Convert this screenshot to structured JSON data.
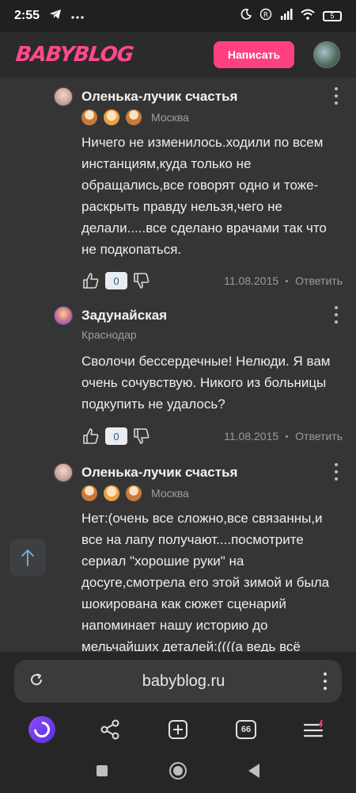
{
  "status_bar": {
    "time": "2:55",
    "battery": "5"
  },
  "header": {
    "logo": "BABYBLOG",
    "write_button": "Написать"
  },
  "comments": [
    {
      "author": "Оленька-лучик счастья",
      "city": "Москва",
      "text": "Ничего не изменилось.ходили по всем инстанциям,куда только не обращались,все говорят одно и тоже-раскрыть правду нельзя,чего не делали.....все сделано врачами так что не подкопаться.",
      "likes": "0",
      "date": "11.08.2015",
      "reply": "Ответить"
    },
    {
      "author": "Задунайская",
      "city": "Краснодар",
      "text": "Сволочи бессердечные! Нелюди. Я вам очень сочувствую. Никого из больницы подкупить не удалось?",
      "likes": "0",
      "date": "11.08.2015",
      "reply": "Ответить"
    },
    {
      "author": "Оленька-лучик счастья",
      "city": "Москва",
      "text": "Нет:(очень все сложно,все связанны,и все на лапу получают....посмотрите сериал \"хорошие руки\" на досуге,смотрела его этой зимой и была шокирована как сюжет сценарий напоминает нашу историю до мельчайших деталей:((((а ведь всё"
    }
  ],
  "browser": {
    "url": "babyblog.ru",
    "tabs_count": "66"
  },
  "icons": {
    "scroll_top": "arrow-up-icon",
    "reload": "reload-icon",
    "share": "share-icon",
    "new_tab": "plus-square-icon",
    "menu": "menu-icon"
  },
  "colors": {
    "brand": "#ff4184",
    "background": "#353535"
  }
}
